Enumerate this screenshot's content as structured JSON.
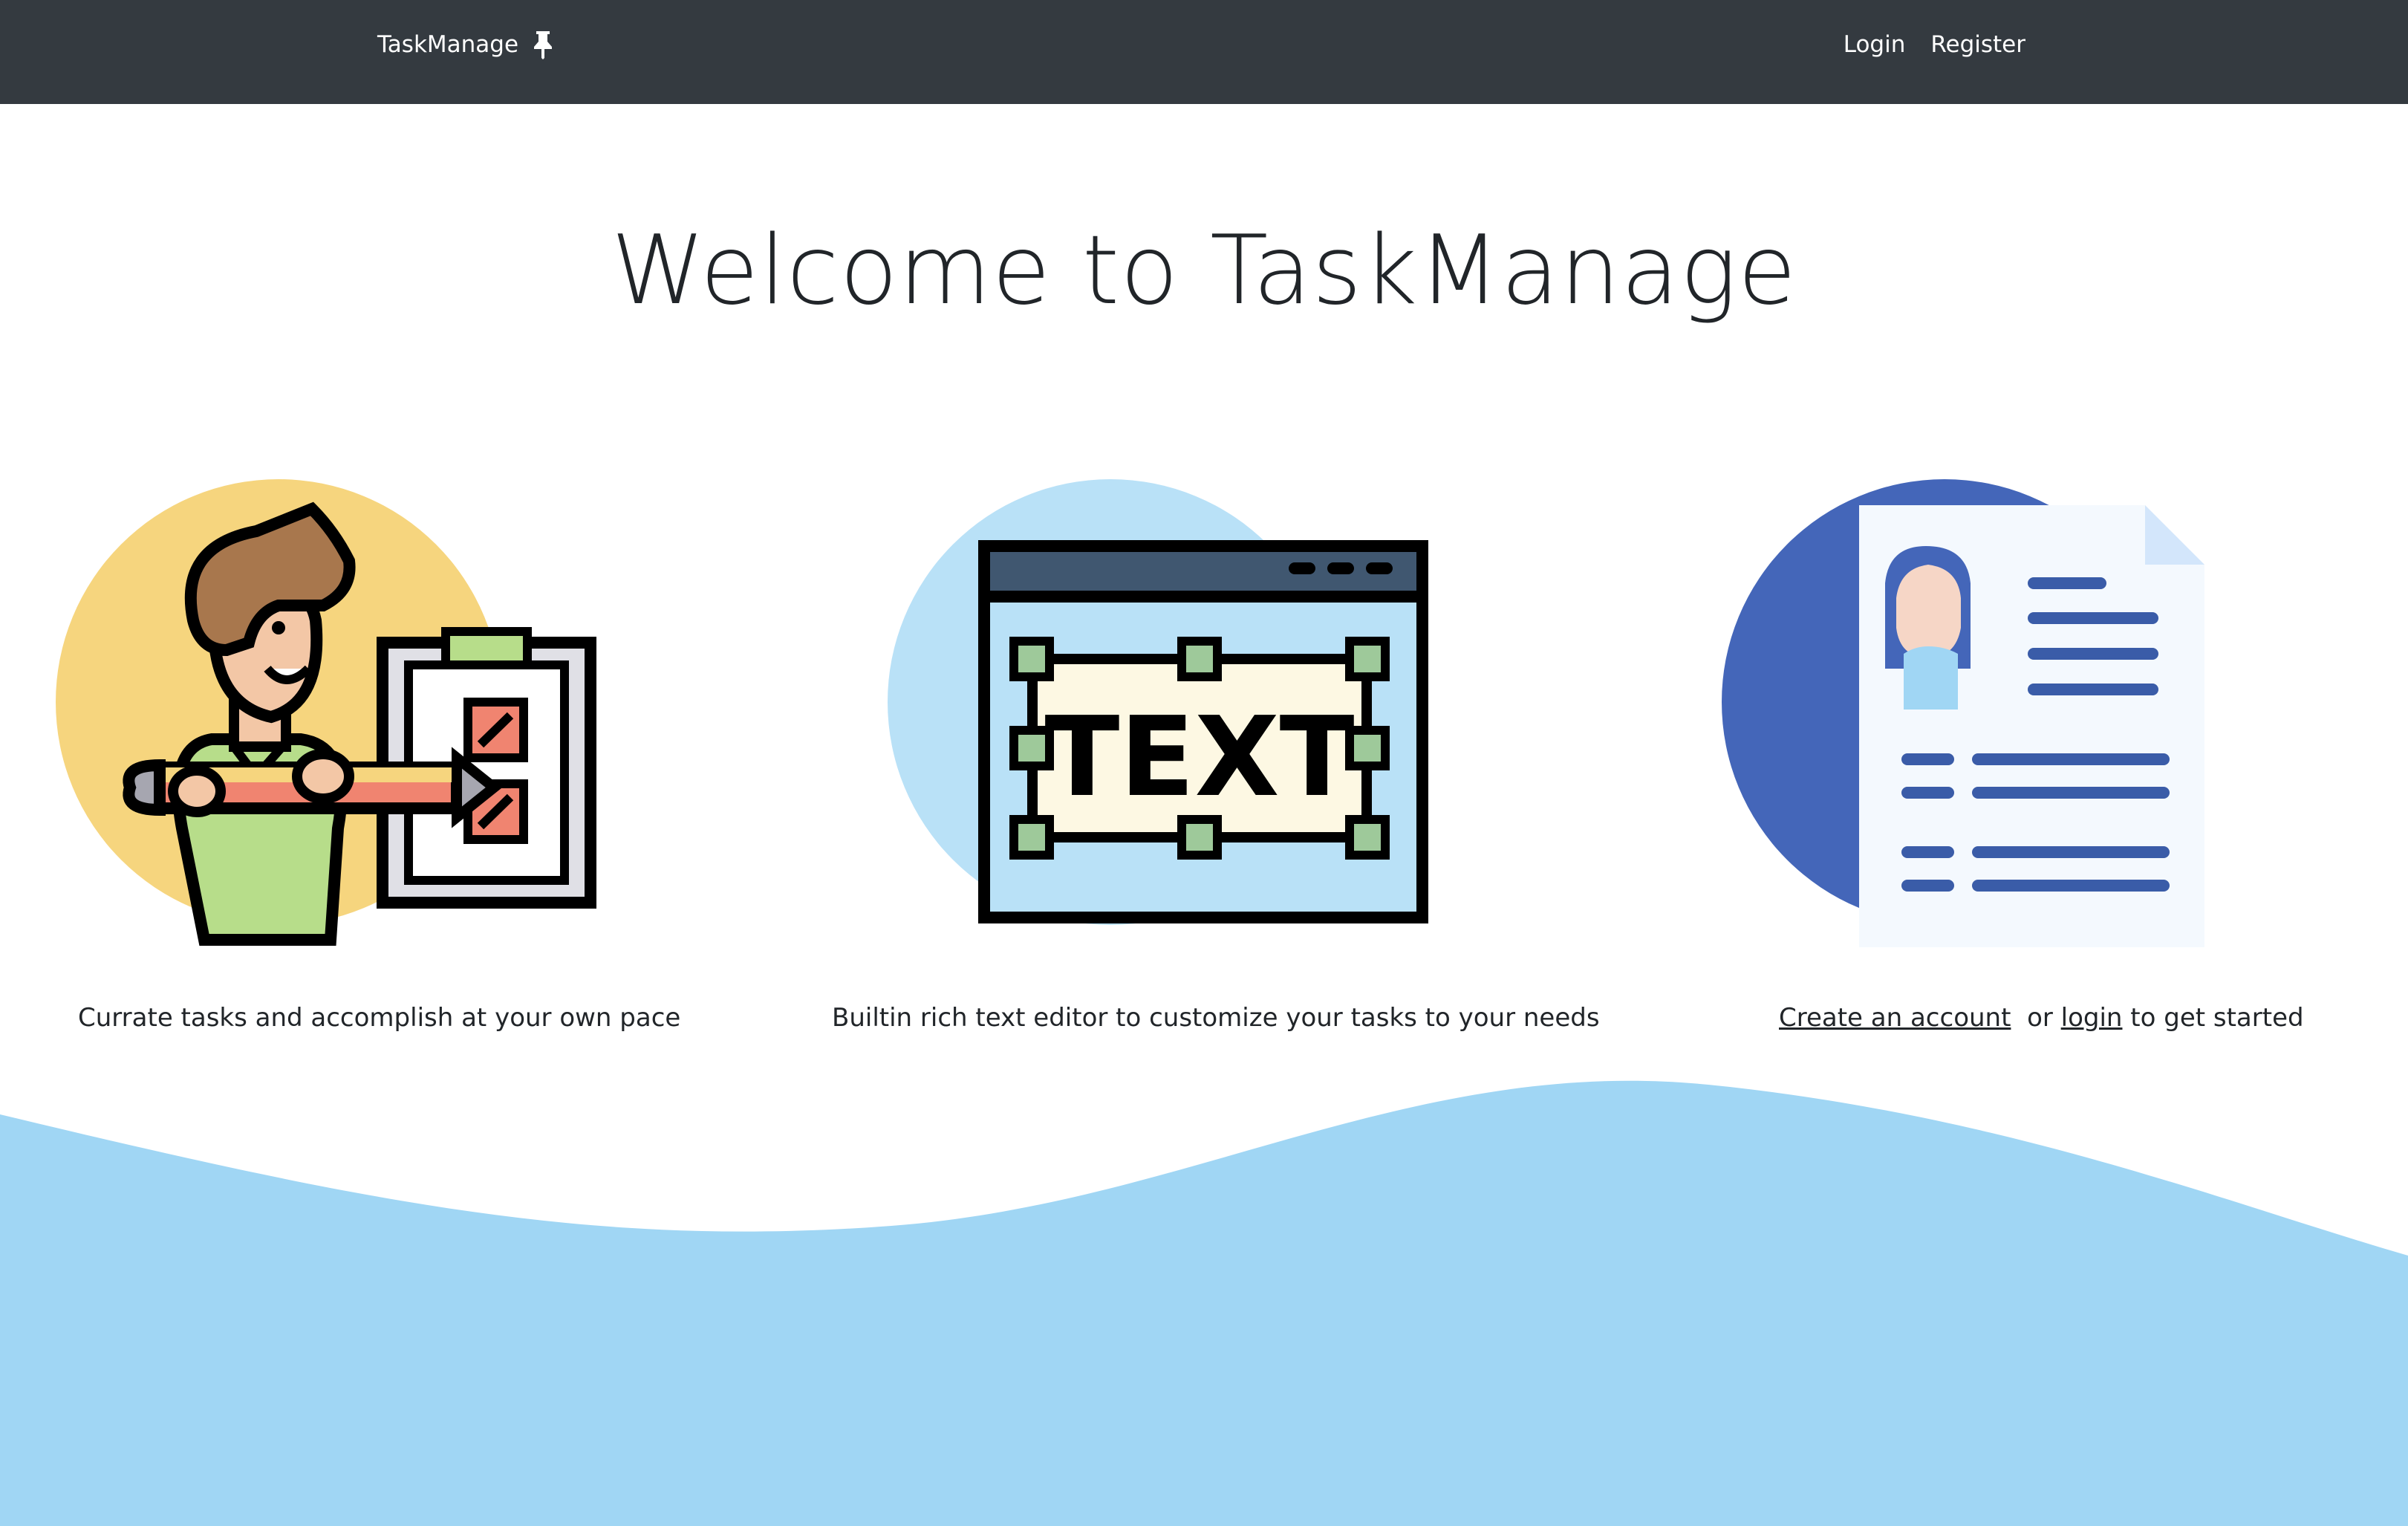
{
  "navbar": {
    "brand": "TaskManage",
    "brand_icon": "pin-icon",
    "links": {
      "login": "Login",
      "register": "Register"
    }
  },
  "hero": {
    "title": "Welcome to TaskManage"
  },
  "features": [
    {
      "icon": "person-checklist-illustration",
      "caption": "Currate tasks and accomplish at your own pace"
    },
    {
      "icon": "text-editor-illustration",
      "caption": "Builtin rich text editor to customize your tasks to your needs"
    },
    {
      "icon": "profile-document-illustration",
      "caption": {
        "create_link": "Create an account",
        "or": "or",
        "login_link": "login",
        "suffix": "to get started"
      }
    }
  ],
  "colors": {
    "navbar_bg": "#343a40",
    "wave": "#a0d6f4",
    "yellow_circle": "#f6d57e",
    "light_blue_circle": "#b9e1f7",
    "dark_blue_circle": "#4466b9"
  }
}
